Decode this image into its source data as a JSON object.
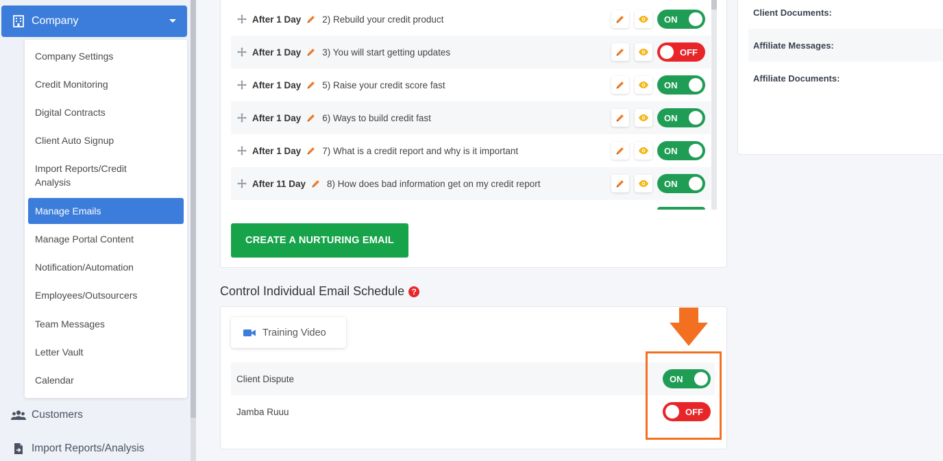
{
  "sidebar": {
    "company_label": "Company",
    "submenu": [
      "Company Settings",
      "Credit Monitoring",
      "Digital Contracts",
      "Client Auto Signup",
      "Import Reports/Credit Analysis",
      "Manage Emails",
      "Manage Portal Content",
      "Notification/Automation",
      "Employees/Outsourcers",
      "Team Messages",
      "Letter Vault",
      "Calendar"
    ],
    "active_item": "Manage Emails",
    "customers_label": "Customers",
    "import_label": "Import Reports/Analysis"
  },
  "nurturing": {
    "rows": [
      {
        "delay": "After 1 Day",
        "subject": "2) Rebuild your credit product",
        "status": "ON"
      },
      {
        "delay": "After 1 Day",
        "subject": "3) You will start getting updates",
        "status": "OFF"
      },
      {
        "delay": "After 1 Day",
        "subject": "5) Raise your credit score fast",
        "status": "ON"
      },
      {
        "delay": "After 1 Day",
        "subject": "6) Ways to build credit fast",
        "status": "ON"
      },
      {
        "delay": "After 1 Day",
        "subject": "7) What is a credit report and why is it important",
        "status": "ON"
      },
      {
        "delay": "After 11 Day",
        "subject": "8) How does bad information get on my credit report",
        "status": "ON"
      }
    ],
    "create_button": "CREATE A NURTURING EMAIL"
  },
  "schedule": {
    "title": "Control Individual Email Schedule",
    "help": "?",
    "training_video": "Training Video",
    "rows": [
      {
        "label": "Client Dispute",
        "status": "ON"
      },
      {
        "label": "Jamba Ruuu",
        "status": "OFF"
      }
    ]
  },
  "right_panel": {
    "rows": [
      "Client Documents:",
      "Affiliate Messages:",
      "Affiliate Documents:"
    ]
  },
  "colors": {
    "primary": "#3c7ddb",
    "on": "#1f9d55",
    "off": "#e8262a",
    "create_btn": "#16a34a",
    "highlight": "#f37021"
  }
}
